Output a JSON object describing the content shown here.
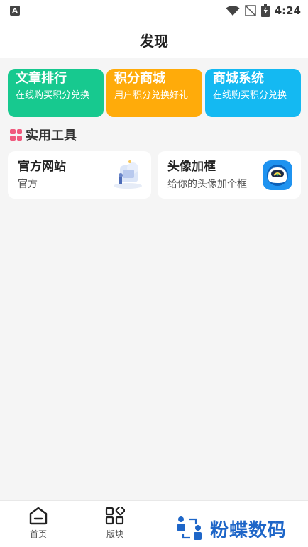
{
  "status_bar": {
    "time": "4:24",
    "icons": [
      "app-a-icon",
      "wifi-icon",
      "no-signal-icon",
      "battery-charging-icon"
    ]
  },
  "header": {
    "title": "发现"
  },
  "feature_cards": [
    {
      "title": "文章排行",
      "desc": "在线购买积分兑换",
      "color": "#17c98f"
    },
    {
      "title": "积分商城",
      "desc": "用户积分兑换好礼",
      "color": "#ffab0a"
    },
    {
      "title": "商城系统",
      "desc": "在线购买积分兑换",
      "color": "#14b9f2"
    }
  ],
  "section": {
    "title": "实用工具",
    "icon": "grid-icon",
    "icon_color": "#f05a7e"
  },
  "tools": [
    {
      "title": "官方网站",
      "desc": "官方",
      "icon": "website-illustration-icon"
    },
    {
      "title": "头像加框",
      "desc": "给你的头像加个框",
      "icon": "avatar-frame-icon"
    }
  ],
  "bottom_nav": [
    {
      "label": "首页",
      "icon": "home-icon"
    },
    {
      "label": "版块",
      "icon": "category-icon"
    }
  ],
  "watermark": {
    "text": "粉蝶数码",
    "color": "#1e66c8"
  }
}
